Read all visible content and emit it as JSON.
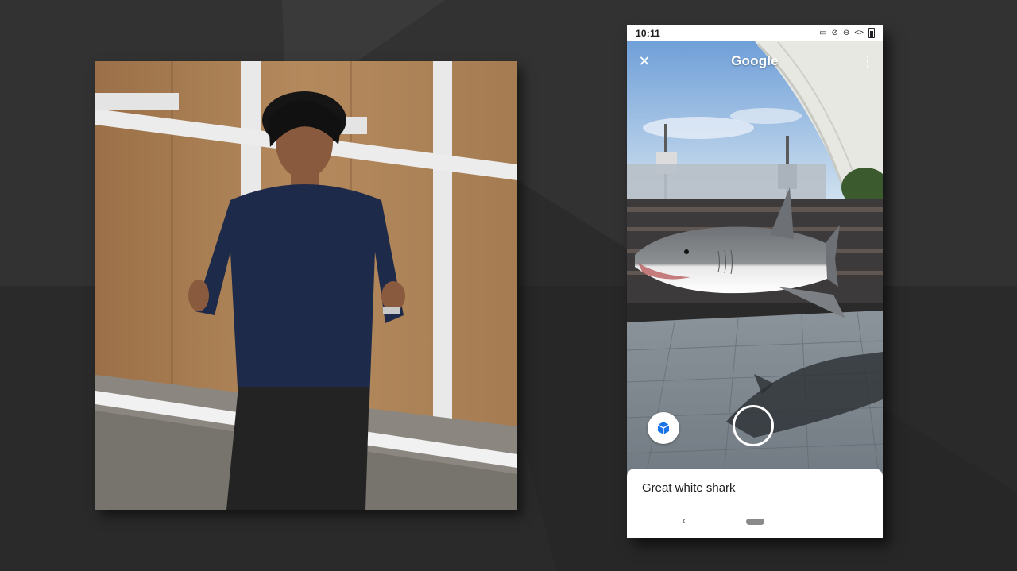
{
  "status_bar": {
    "time": "10:11",
    "icons": [
      "cast-icon",
      "mute-icon",
      "dnd-icon",
      "data-saver-icon",
      "battery-icon"
    ]
  },
  "lens_header": {
    "close_icon": "close-icon",
    "logo": "Google",
    "more_icon": "more-vert-icon"
  },
  "ar_controls": {
    "view_3d_icon": "cube-icon",
    "shutter_icon": "shutter-ring"
  },
  "result_sheet": {
    "title": "Great white shark"
  },
  "nav_bar": {
    "back_icon": "back-chevron-icon",
    "home_icon": "home-pill-icon"
  },
  "colors": {
    "background": "#2f2f2f",
    "sheet": "#ffffff",
    "sky": "#8fb6e6",
    "floor": "#7e8790"
  }
}
